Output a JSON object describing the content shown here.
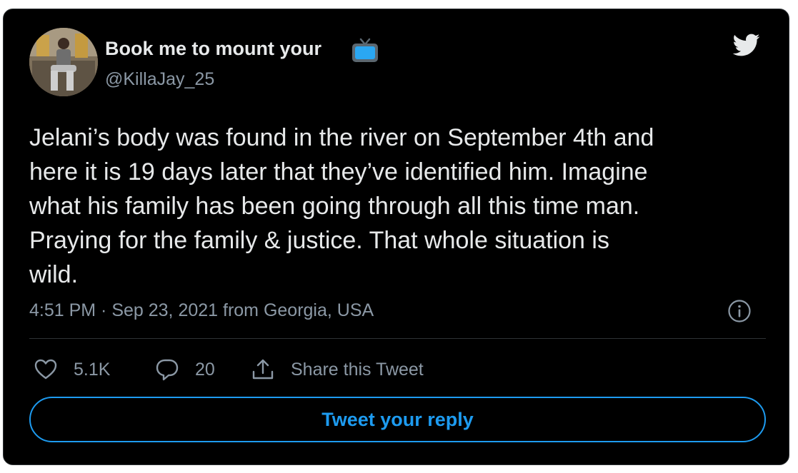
{
  "tweet": {
    "author": {
      "display_name": "Book me to mount your",
      "name_emoji": "tv-icon",
      "handle": "@KillaJay_25"
    },
    "brand_icon": "twitter-bird-icon",
    "text": "Jelani’s body was found in the river on September 4th and\nhere it is 19 days later that they’ve identified him. Imagine\nwhat his family has been going through all this time man.\nPraying for the family & justice. That whole situation is\nwild.",
    "timestamp": "4:51 PM · Sep 23, 2021 from Georgia, USA",
    "info_icon": "info-icon"
  },
  "actions": {
    "likes": "5.1K",
    "replies": "20",
    "share_label": "Share this Tweet"
  },
  "reply_button_label": "Tweet your reply",
  "colors": {
    "background": "#000000",
    "text_primary": "#e7e9ea",
    "text_secondary": "#8b98a5",
    "accent": "#1d9bf0",
    "divider": "#2f3336"
  }
}
